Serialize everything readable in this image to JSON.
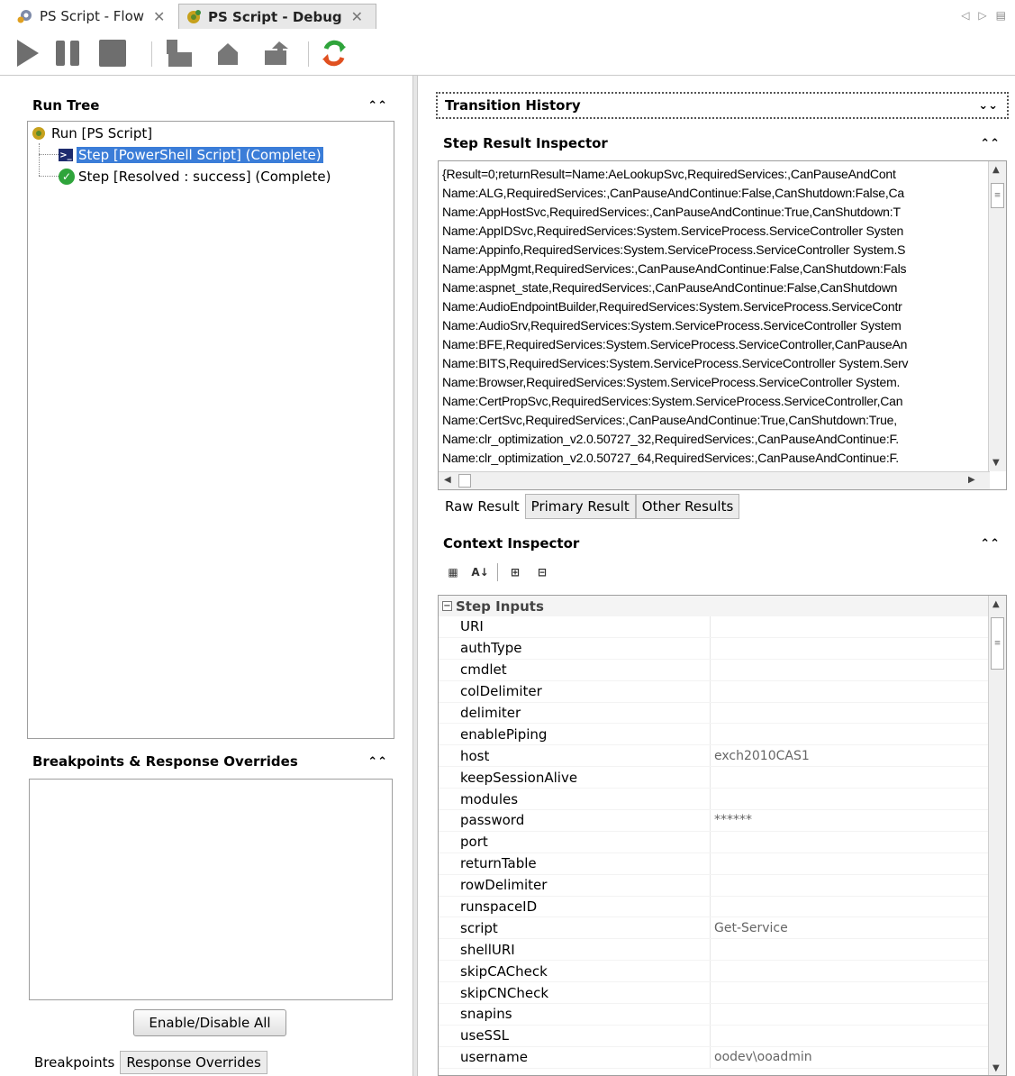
{
  "tabs": [
    {
      "label": "PS Script - Flow",
      "icon": "gear-flow-icon",
      "active": false
    },
    {
      "label": "PS Script - Debug",
      "icon": "debug-gear-icon",
      "active": true
    }
  ],
  "toolbar": {
    "buttons": [
      "play-icon",
      "pause-icon",
      "stop-icon",
      "step-into-icon",
      "step-over-icon",
      "step-out-icon",
      "refresh-debug-icon"
    ]
  },
  "run_tree": {
    "title": "Run Tree",
    "root": "Run [PS Script]",
    "items": [
      {
        "label": "Step [PowerShell Script] (Complete)",
        "icon": "powershell-icon",
        "selected": true
      },
      {
        "label": "Step [Resolved : success] (Complete)",
        "icon": "success-check-icon",
        "selected": false
      }
    ]
  },
  "breakpoints": {
    "title": "Breakpoints & Response Overrides",
    "enable_all_label": "Enable/Disable All",
    "tabs": [
      "Breakpoints",
      "Response Overrides"
    ]
  },
  "transition_history": {
    "title": "Transition History"
  },
  "step_result_inspector": {
    "title": "Step Result Inspector",
    "lines": [
      "{Result=0;returnResult=Name:AeLookupSvc,RequiredServices:,CanPauseAndCont",
      "Name:ALG,RequiredServices:,CanPauseAndContinue:False,CanShutdown:False,Ca",
      "Name:AppHostSvc,RequiredServices:,CanPauseAndContinue:True,CanShutdown:T",
      "Name:AppIDSvc,RequiredServices:System.ServiceProcess.ServiceController Systen",
      "Name:Appinfo,RequiredServices:System.ServiceProcess.ServiceController System.S",
      "Name:AppMgmt,RequiredServices:,CanPauseAndContinue:False,CanShutdown:Fals",
      "Name:aspnet_state,RequiredServices:,CanPauseAndContinue:False,CanShutdown",
      "Name:AudioEndpointBuilder,RequiredServices:System.ServiceProcess.ServiceContr",
      "Name:AudioSrv,RequiredServices:System.ServiceProcess.ServiceController System",
      "Name:BFE,RequiredServices:System.ServiceProcess.ServiceController,CanPauseAn",
      "Name:BITS,RequiredServices:System.ServiceProcess.ServiceController System.Serv",
      "Name:Browser,RequiredServices:System.ServiceProcess.ServiceController System.",
      "Name:CertPropSvc,RequiredServices:System.ServiceProcess.ServiceController,Can",
      "Name:CertSvc,RequiredServices:,CanPauseAndContinue:True,CanShutdown:True,",
      "Name:clr_optimization_v2.0.50727_32,RequiredServices:,CanPauseAndContinue:F.",
      "Name:clr_optimization_v2.0.50727_64,RequiredServices:,CanPauseAndContinue:F."
    ],
    "tabs": [
      "Raw Result",
      "Primary Result",
      "Other Results"
    ]
  },
  "context_inspector": {
    "title": "Context Inspector",
    "category": "Step Inputs",
    "rows": [
      {
        "key": "URI",
        "value": ""
      },
      {
        "key": "authType",
        "value": ""
      },
      {
        "key": "cmdlet",
        "value": ""
      },
      {
        "key": "colDelimiter",
        "value": ""
      },
      {
        "key": "delimiter",
        "value": ""
      },
      {
        "key": "enablePiping",
        "value": ""
      },
      {
        "key": "host",
        "value": "exch2010CAS1"
      },
      {
        "key": "keepSessionAlive",
        "value": ""
      },
      {
        "key": "modules",
        "value": ""
      },
      {
        "key": "password",
        "value": "******"
      },
      {
        "key": "port",
        "value": ""
      },
      {
        "key": "returnTable",
        "value": ""
      },
      {
        "key": "rowDelimiter",
        "value": ""
      },
      {
        "key": "runspaceID",
        "value": ""
      },
      {
        "key": "script",
        "value": "Get-Service"
      },
      {
        "key": "shellURI",
        "value": ""
      },
      {
        "key": "skipCACheck",
        "value": ""
      },
      {
        "key": "skipCNCheck",
        "value": ""
      },
      {
        "key": "snapins",
        "value": ""
      },
      {
        "key": "useSSL",
        "value": ""
      },
      {
        "key": "username",
        "value": "oodev\\ooadmin"
      }
    ]
  }
}
